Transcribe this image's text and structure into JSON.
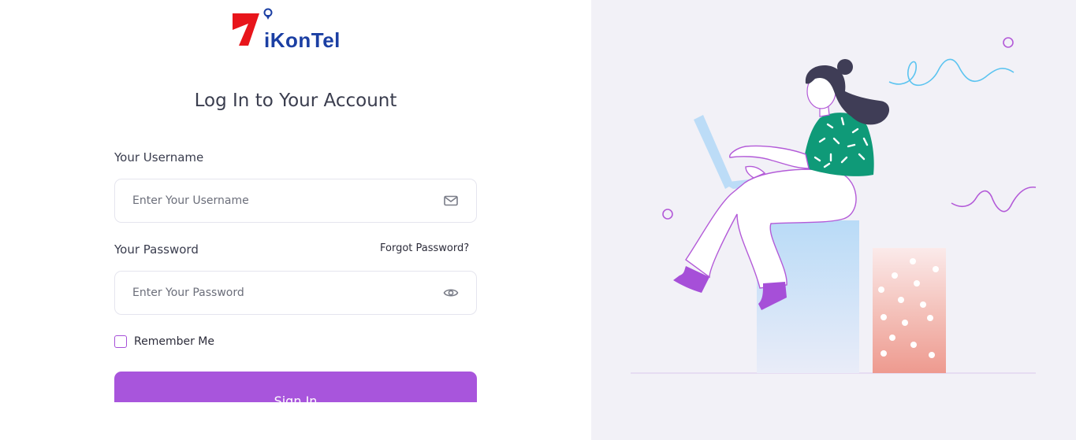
{
  "brand": {
    "name": "iKonTel",
    "logo_red": "#e8151b",
    "logo_blue": "#1b3fa3"
  },
  "page": {
    "title": "Log In to Your Account"
  },
  "form": {
    "username_label": "Your Username",
    "username_placeholder": "Enter Your Username",
    "username_icon": "mail-icon",
    "password_label": "Your Password",
    "password_placeholder": "Enter Your Password",
    "password_icon": "eye-icon",
    "forgot_password": "Forgot Password?",
    "remember_me": "Remember Me",
    "submit_label": "Sign In"
  },
  "colors": {
    "accent": "#a855dc",
    "right_panel_bg": "#f2f1f7",
    "shirt": "#0f9a78",
    "chart_blue": "#bcdcf7",
    "chart_pink": "#ee9a8f"
  }
}
